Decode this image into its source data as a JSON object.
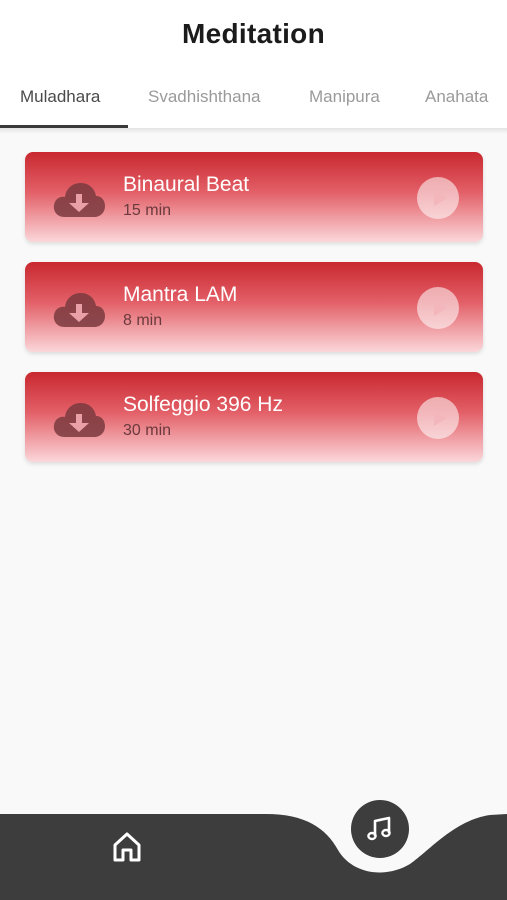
{
  "header": {
    "title": "Meditation"
  },
  "tabs": [
    {
      "label": "Muladhara",
      "active": true
    },
    {
      "label": "Svadhishthana",
      "active": false
    },
    {
      "label": "Manipura",
      "active": false
    },
    {
      "label": "Anahata",
      "active": false
    }
  ],
  "tracks": [
    {
      "title": "Binaural Beat",
      "duration": "15 min"
    },
    {
      "title": "Mantra LAM",
      "duration": "8 min"
    },
    {
      "title": "Solfeggio 396 Hz",
      "duration": "30 min"
    }
  ],
  "icons": {
    "download": "cloud-download-icon",
    "play": "play-icon",
    "home": "home-icon",
    "music": "music-note-icon"
  },
  "colors": {
    "card_top": "#c9282f",
    "card_bottom": "#fbd7da",
    "nav_background": "#3d3d3d",
    "title_text": "#1b1b1b"
  }
}
